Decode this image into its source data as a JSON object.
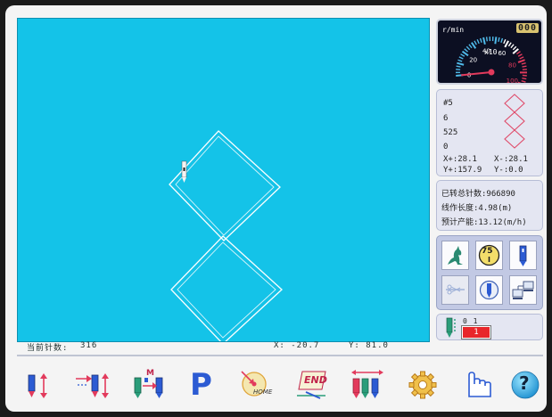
{
  "gauge": {
    "unit": "r/min",
    "multiplier": "x10",
    "counter": "000",
    "scale": [
      "0",
      "20",
      "40",
      "60",
      "80",
      "100"
    ],
    "needle_value": 0
  },
  "info": {
    "color_no": "#5",
    "needle_no": "6",
    "stitch_count": "525",
    "zero": "0",
    "x_pos": "X+:28.1",
    "x_neg": "X-:28.1",
    "y_pos": "Y+:157.9",
    "y_neg": "Y-:0.0"
  },
  "stats": {
    "total_stitches_label": "已转总针数:",
    "total_stitches_value": "966890",
    "thread_length_label": "线作长度:",
    "thread_length_value": "4.98(m)",
    "output_label": "预计产能:",
    "output_value": "13.12(m/h)"
  },
  "speed_badge": "75",
  "needle_panel": {
    "needle_ids": "0 1",
    "current": "1"
  },
  "statusbar": {
    "current_stitch_label": "当前针数:",
    "current_stitch_value": "316",
    "x_coord": "X: -20.7",
    "y_coord": "Y: 81.0"
  },
  "toolbar": {
    "p_label": "P",
    "end_label": "END",
    "home_label": "HOME",
    "m_label": "M",
    "help_label": "?"
  },
  "colors": {
    "canvas": "#14c3e8",
    "panel": "#e4e6f2",
    "accent_red": "#e8262b",
    "pattern_line": "#ffffff"
  }
}
